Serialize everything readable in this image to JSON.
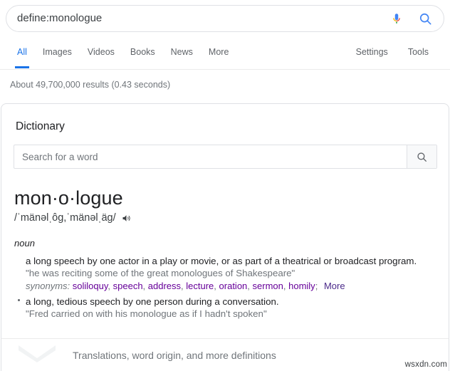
{
  "search": {
    "query": "define:monologue",
    "mic_icon": "microphone-icon",
    "search_icon": "search-icon"
  },
  "nav": {
    "left_items": [
      {
        "label": "All",
        "active": true
      },
      {
        "label": "Images",
        "active": false
      },
      {
        "label": "Videos",
        "active": false
      },
      {
        "label": "Books",
        "active": false
      },
      {
        "label": "News",
        "active": false
      },
      {
        "label": "More",
        "active": false
      }
    ],
    "right_items": [
      {
        "label": "Settings"
      },
      {
        "label": "Tools"
      }
    ]
  },
  "result_stats": "About 49,700,000 results (0.43 seconds)",
  "dictionary": {
    "title": "Dictionary",
    "search_placeholder": "Search for a word",
    "search_value": "",
    "headword": "mon·o·logue",
    "phonetic": "/ˈmänəlˌg, ˈmänəlˌäg/",
    "phonetic_display": "/ˈmänəlˌôg,ˈmänəlˌäg/",
    "speaker_icon": "speaker-icon",
    "part_of_speech": "noun",
    "senses": [
      {
        "definition": "a long speech by one actor in a play or movie, or as part of a theatrical or broadcast program.",
        "example": "\"he was reciting some of the great monologues of Shakespeare\"",
        "synonyms_label": "synonyms:",
        "synonyms": [
          "soliloquy",
          "speech",
          "address",
          "lecture",
          "oration",
          "sermon",
          "homily"
        ],
        "synonyms_more": "More"
      },
      {
        "definition": "a long, tedious speech by one person during a conversation.",
        "example": "\"Fred carried on with his monologue as if I hadn't spoken\""
      }
    ]
  },
  "footer": {
    "label": "Translations, word origin, and more definitions",
    "chevron_icon": "chevron-down-icon"
  },
  "watermark": "wsxdn.com",
  "colors": {
    "accent_blue": "#1a73e8",
    "link_purple": "#660099",
    "muted_text": "#70757a",
    "border": "#dfe1e5"
  }
}
